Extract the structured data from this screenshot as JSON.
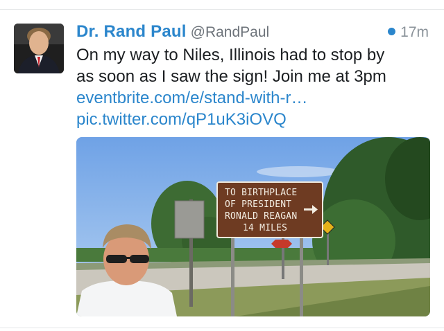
{
  "tweet": {
    "display_name": "Dr. Rand Paul",
    "handle": "@RandPaul",
    "timestamp": "17m",
    "text_lines": [
      "On my way to Niles, Illinois had to stop by",
      "as soon as I saw the sign! Join me at 3pm"
    ],
    "link_1": "eventbrite.com/e/stand-with-r…",
    "link_2": "pic.twitter.com/qP1uK3iOVQ"
  },
  "photo": {
    "sign_lines": [
      "TO BIRTHPLACE",
      "OF  PRESIDENT",
      "RONALD REAGAN",
      "14 MILES"
    ]
  },
  "colors": {
    "accent": "#2b86cc",
    "text": "#1b1e21",
    "muted": "#6d737a"
  },
  "icons": {
    "unread": "unread-dot-icon",
    "sign_arrow": "right-arrow-icon"
  }
}
